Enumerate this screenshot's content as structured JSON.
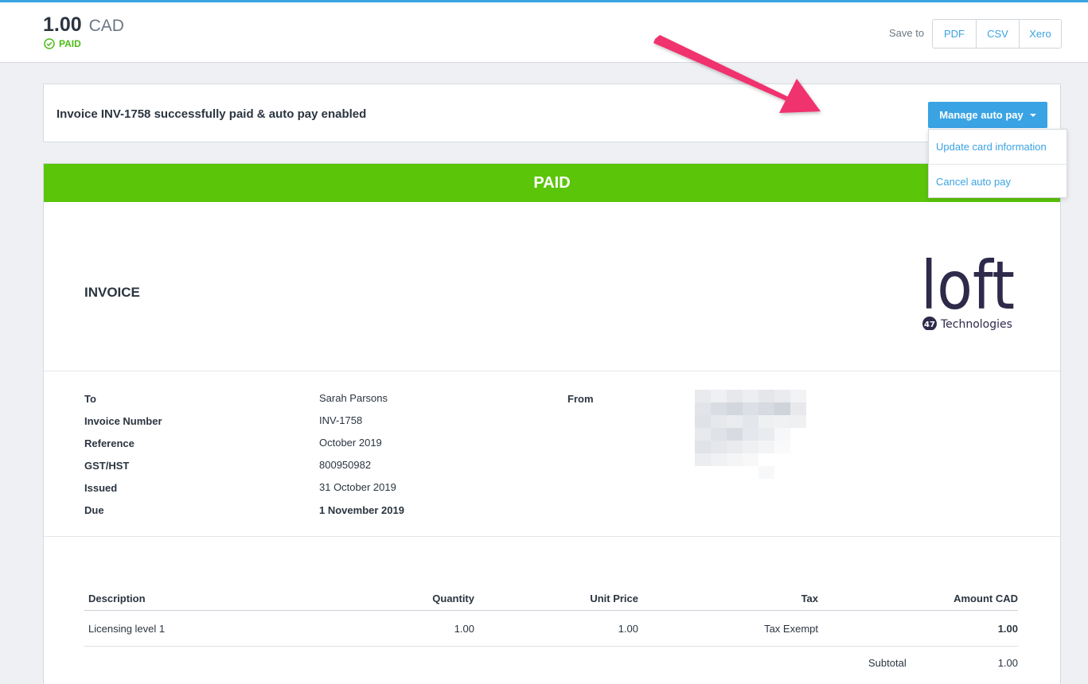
{
  "header": {
    "amount": "1.00",
    "currency": "CAD",
    "status": "PAID",
    "save_to_label": "Save to",
    "save_buttons": [
      "PDF",
      "CSV",
      "Xero"
    ]
  },
  "notice": {
    "message": "Invoice INV-1758 successfully paid & auto pay enabled",
    "manage_button": "Manage auto pay",
    "dropdown_items": [
      "Update card information",
      "Cancel auto pay"
    ]
  },
  "invoice": {
    "banner": "PAID",
    "title": "INVOICE",
    "logo": {
      "word": "loft",
      "badge": "47",
      "tagline": "Technologies"
    },
    "details": {
      "to_label": "To",
      "to_value": "Sarah Parsons",
      "number_label": "Invoice Number",
      "number_value": "INV-1758",
      "reference_label": "Reference",
      "reference_value": "October 2019",
      "gst_label": "GST/HST",
      "gst_value": "800950982",
      "issued_label": "Issued",
      "issued_value": "31 October 2019",
      "due_label": "Due",
      "due_value": "1 November 2019",
      "from_label": "From"
    },
    "table": {
      "headers": [
        "Description",
        "Quantity",
        "Unit Price",
        "Tax",
        "Amount CAD"
      ],
      "rows": [
        [
          "Licensing level 1",
          "1.00",
          "1.00",
          "Tax Exempt",
          "1.00"
        ]
      ],
      "subtotal_label": "Subtotal",
      "subtotal_value": "1.00"
    }
  },
  "colors": {
    "accent": "#3aa3e3",
    "paid_green": "#5bc50a",
    "annotation_arrow": "#f0306e"
  }
}
